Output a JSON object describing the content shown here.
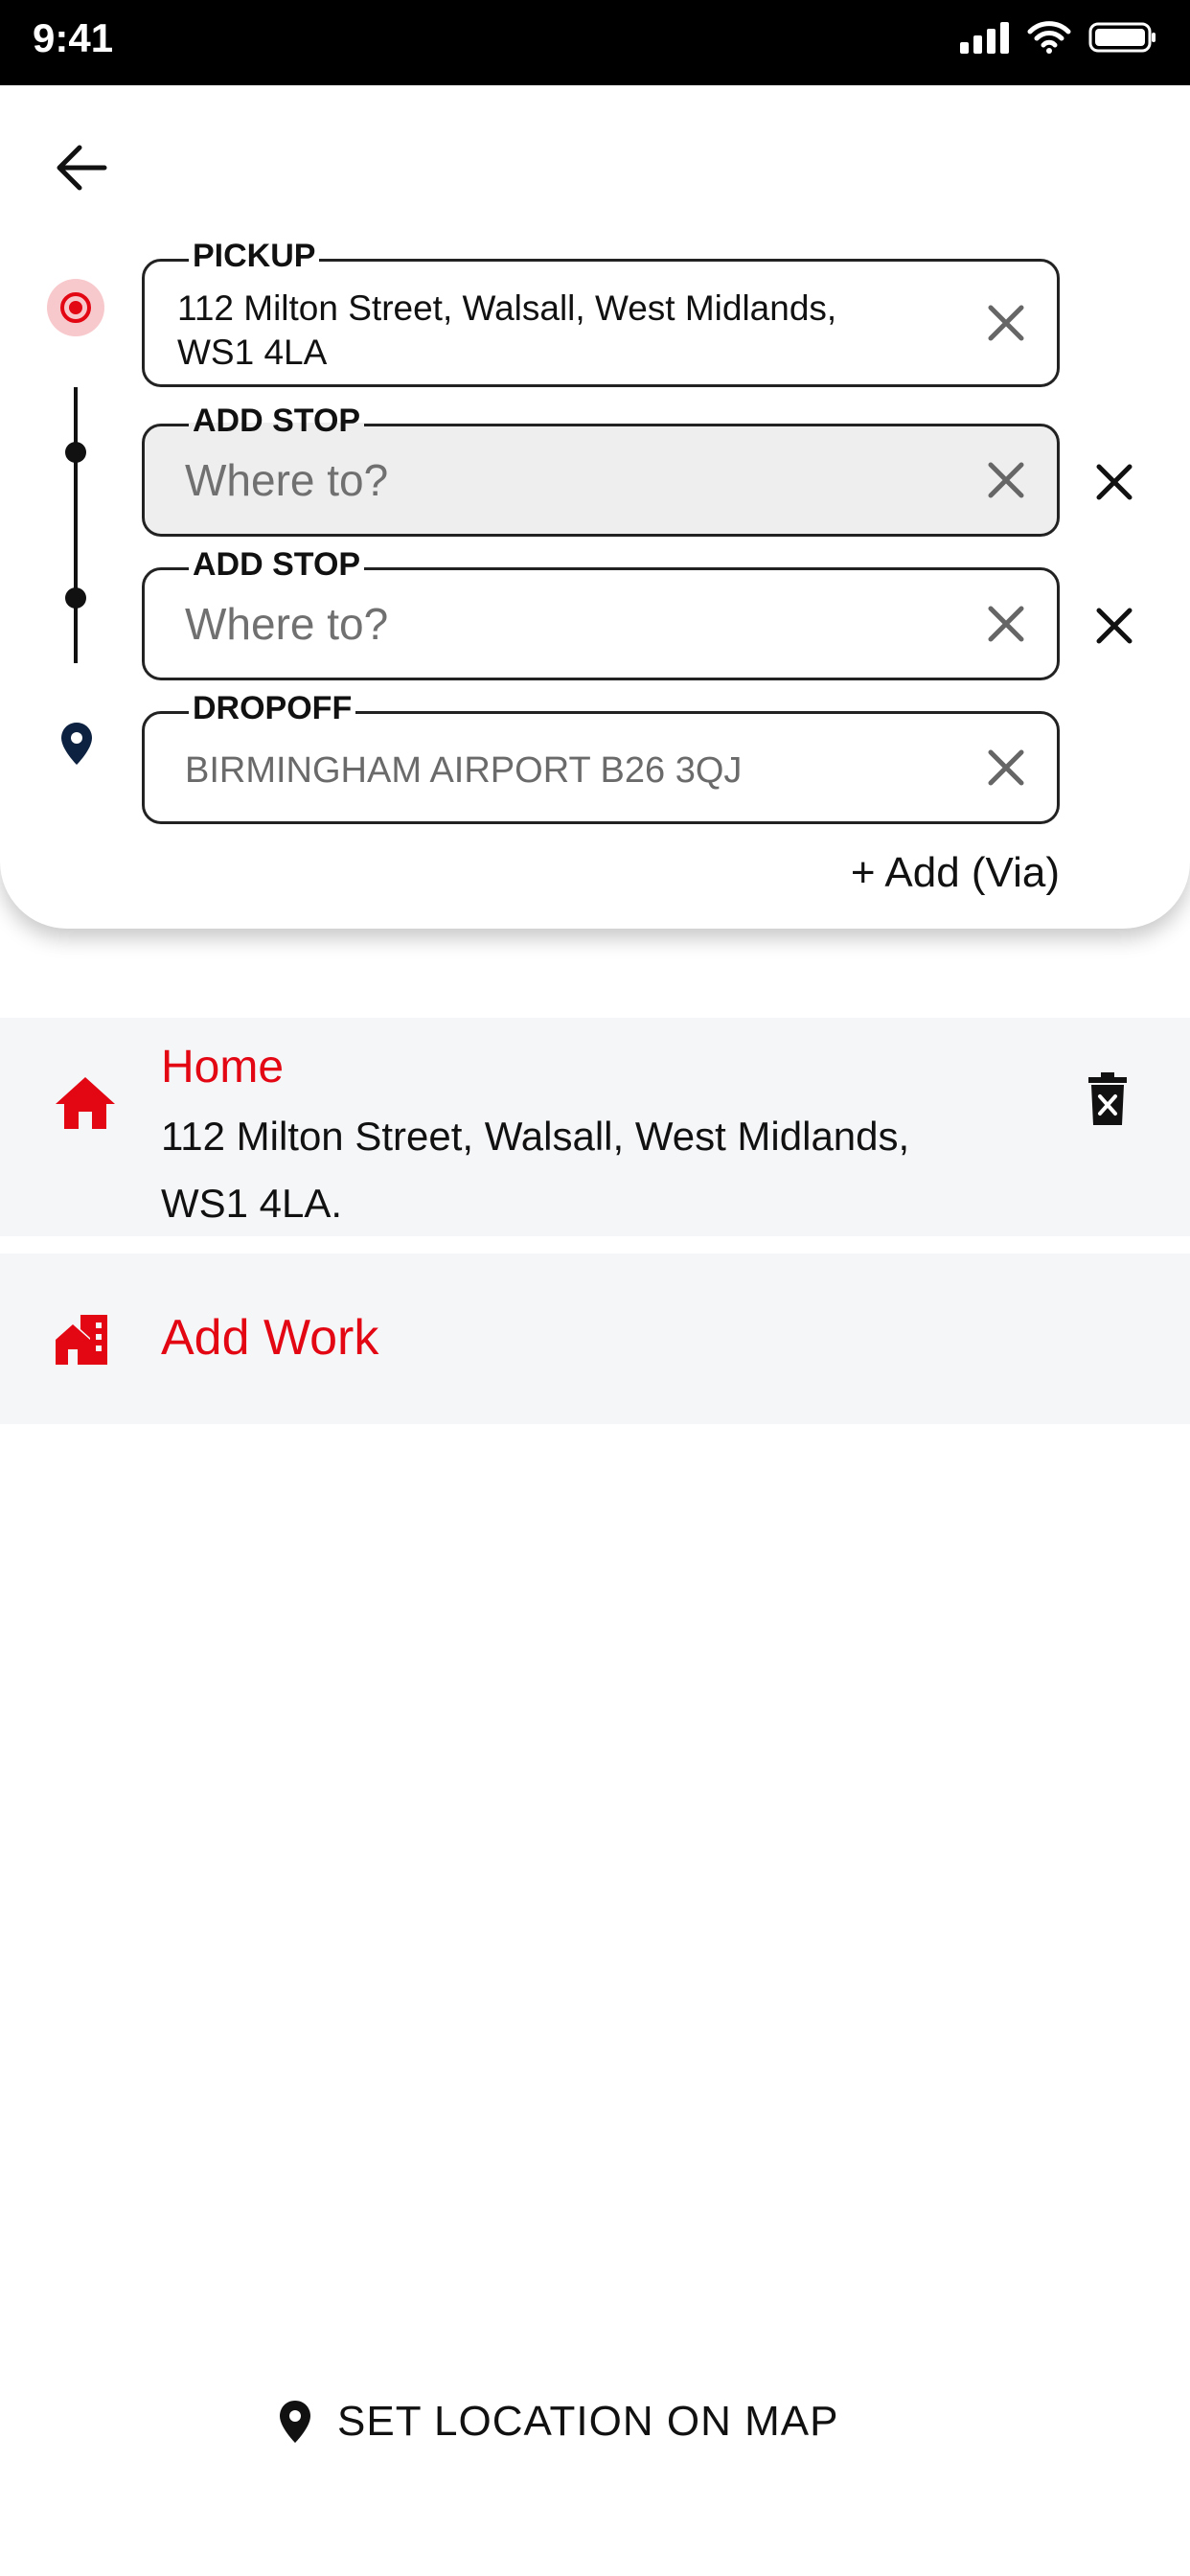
{
  "status_bar": {
    "time": "9:41"
  },
  "route": {
    "pickup": {
      "label": "PICKUP",
      "value_line1": "112 Milton Street, Walsall, West Midlands,",
      "value_line2": "WS1 4LA"
    },
    "stops": [
      {
        "label": "ADD STOP",
        "placeholder": "Where to?"
      },
      {
        "label": "ADD STOP",
        "placeholder": "Where to?"
      }
    ],
    "dropoff": {
      "label": "DROPOFF",
      "value": "BIRMINGHAM AIRPORT B26 3QJ"
    },
    "add_via_label": "+ Add (Via)"
  },
  "saved_places": {
    "home": {
      "title": "Home",
      "address_line1": "112 Milton Street, Walsall, West Midlands,",
      "address_line2": "WS1 4LA."
    },
    "work": {
      "title": "Add Work"
    }
  },
  "map_link": {
    "label": "SET LOCATION ON MAP"
  },
  "icons": {
    "back": "arrow-left-icon",
    "pickup_marker": "target-icon",
    "dropoff_marker": "map-pin-icon",
    "clear": "close-icon",
    "home": "house-icon",
    "work": "office-building-icon",
    "delete": "trash-icon"
  },
  "colors": {
    "accent": "#e30613",
    "pin": "#0d2240",
    "list_bg": "#f5f6f8",
    "filled_input": "#eeeeee"
  }
}
